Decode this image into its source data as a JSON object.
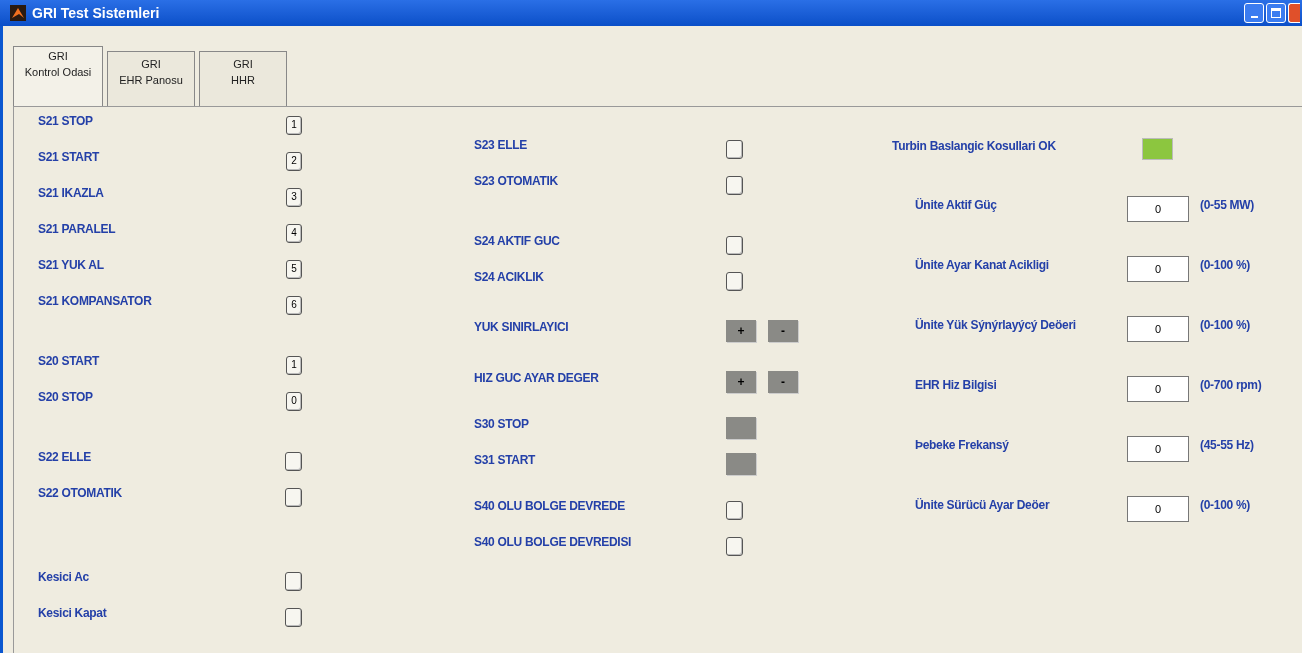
{
  "window": {
    "title": "GRI Test Sistemleri"
  },
  "tabs": [
    {
      "lines": [
        "GRI",
        "Kontrol Odasi"
      ],
      "selected": true
    },
    {
      "lines": [
        "GRI",
        "EHR Panosu"
      ],
      "selected": false
    },
    {
      "lines": [
        "GRI",
        "HHR"
      ],
      "selected": false
    }
  ],
  "left_column": [
    {
      "label": "S21 STOP",
      "kind": "numbered",
      "key": "1"
    },
    {
      "label": "S21 START",
      "kind": "numbered",
      "key": "2"
    },
    {
      "label": "S21 IKAZLA",
      "kind": "numbered",
      "key": "3"
    },
    {
      "label": "S21 PARALEL",
      "kind": "numbered",
      "key": "4"
    },
    {
      "label": "S21 YUK AL",
      "kind": "numbered",
      "key": "5"
    },
    {
      "label": "S21 KOMPANSATOR",
      "kind": "numbered",
      "key": "6"
    },
    {
      "label": "S20 START",
      "kind": "numbered",
      "key": "1"
    },
    {
      "label": "S20 STOP",
      "kind": "numbered",
      "key": "0"
    },
    {
      "label": "S22 ELLE",
      "kind": "toggle",
      "checked": false
    },
    {
      "label": "S22 OTOMATIK",
      "kind": "toggle",
      "checked": false
    },
    {
      "label": "Kesici Ac",
      "kind": "toggle",
      "checked": false
    },
    {
      "label": "Kesici Kapat",
      "kind": "toggle",
      "checked": false
    }
  ],
  "middle_column": [
    {
      "label": "S23 ELLE",
      "kind": "toggle",
      "checked": false
    },
    {
      "label": "S23 OTOMATIK",
      "kind": "toggle",
      "checked": false
    },
    {
      "label": "S24 AKTIF GUC",
      "kind": "toggle",
      "checked": false
    },
    {
      "label": "S24 ACIKLIK",
      "kind": "toggle",
      "checked": false
    },
    {
      "label": "YUK SINIRLAYICI",
      "kind": "plusminus",
      "plus": "+",
      "minus": "-"
    },
    {
      "label": "HIZ GUC AYAR DEGER",
      "kind": "plusminus",
      "plus": "+",
      "minus": "-"
    },
    {
      "label": "S30 STOP",
      "kind": "lamp"
    },
    {
      "label": "S31 START",
      "kind": "lamp"
    },
    {
      "label": "S40 OLU BOLGE DEVREDE",
      "kind": "toggle",
      "checked": false
    },
    {
      "label": "S40 OLU BOLGE DEVREDISI",
      "kind": "toggle",
      "checked": false
    }
  ],
  "status": {
    "label": "Turbin Baslangic Kosullari OK",
    "on": true,
    "color": "#8cc63f"
  },
  "fields": [
    {
      "label": "Ünite Aktif Güç",
      "value": "0",
      "unit": "(0-55 MW)"
    },
    {
      "label": "Ünite Ayar Kanat Acikligi",
      "value": "0",
      "unit": "(0-100 %)"
    },
    {
      "label": "Ünite Yük Sýnýrlayýcý Deöeri",
      "value": "0",
      "unit": "(0-100 %)"
    },
    {
      "label": "EHR Hiz Bilgisi",
      "value": "0",
      "unit": "(0-700 rpm)"
    },
    {
      "label": "Þebeke Frekansý",
      "value": "0",
      "unit": "(45-55 Hz)"
    },
    {
      "label": "Ünite Sürücü Ayar Deöer",
      "value": "0",
      "unit": "(0-100 %)"
    }
  ]
}
